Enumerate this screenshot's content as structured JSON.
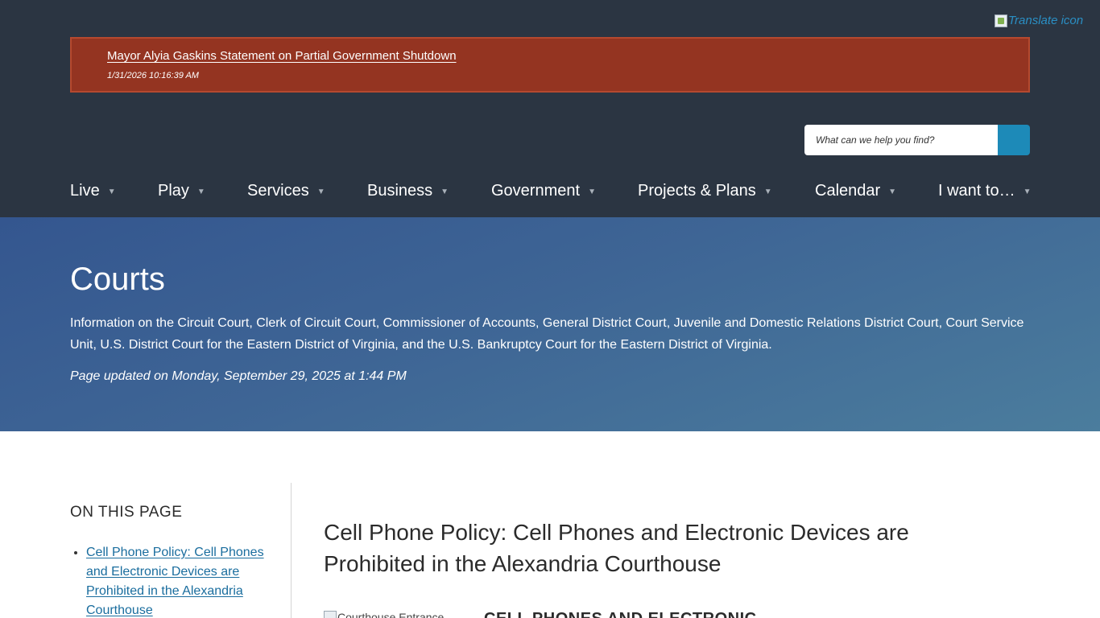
{
  "translate": {
    "alt_text": "Translate icon"
  },
  "alert": {
    "link_text": "Mayor Alyia Gaskins Statement on Partial Government Shutdown",
    "timestamp": "1/31/2026 10:16:39 AM"
  },
  "search": {
    "placeholder": "What can we help you find?",
    "icon": "search-icon"
  },
  "nav": {
    "items": [
      {
        "label": "Live"
      },
      {
        "label": "Play"
      },
      {
        "label": "Services"
      },
      {
        "label": "Business"
      },
      {
        "label": "Government"
      },
      {
        "label": "Projects & Plans"
      },
      {
        "label": "Calendar"
      },
      {
        "label": "I want to…"
      }
    ],
    "caret": "▼"
  },
  "hero": {
    "title": "Courts",
    "description": "Information on the Circuit Court, Clerk of Circuit Court, Commissioner of Accounts, General District Court, Juvenile and Domestic Relations District Court, Court Service Unit, U.S. District Court for the Eastern District of Virginia, and the U.S. Bankruptcy Court for the Eastern District of Virginia.",
    "updated": "Page updated on Monday, September 29, 2025 at 1:44 PM"
  },
  "sidebar": {
    "title": "ON THIS PAGE",
    "links": [
      {
        "label": "Cell Phone Policy: Cell Phones and Electronic Devices are Prohibited in the Alexandria Courthouse"
      }
    ]
  },
  "main": {
    "heading": "Cell Phone Policy: Cell Phones and Electronic Devices are Prohibited in the Alexandria Courthouse",
    "image_alt": "Courthouse Entrance",
    "subheading": "CELL PHONES AND ELECTRONIC"
  },
  "colors": {
    "header_bg": "#2b3542",
    "alert_bg": "#943421",
    "accent": "#1d8ab8",
    "link": "#1a6d9e",
    "hero_gradient_start": "#34568f",
    "hero_gradient_end": "#4b7d9d"
  }
}
